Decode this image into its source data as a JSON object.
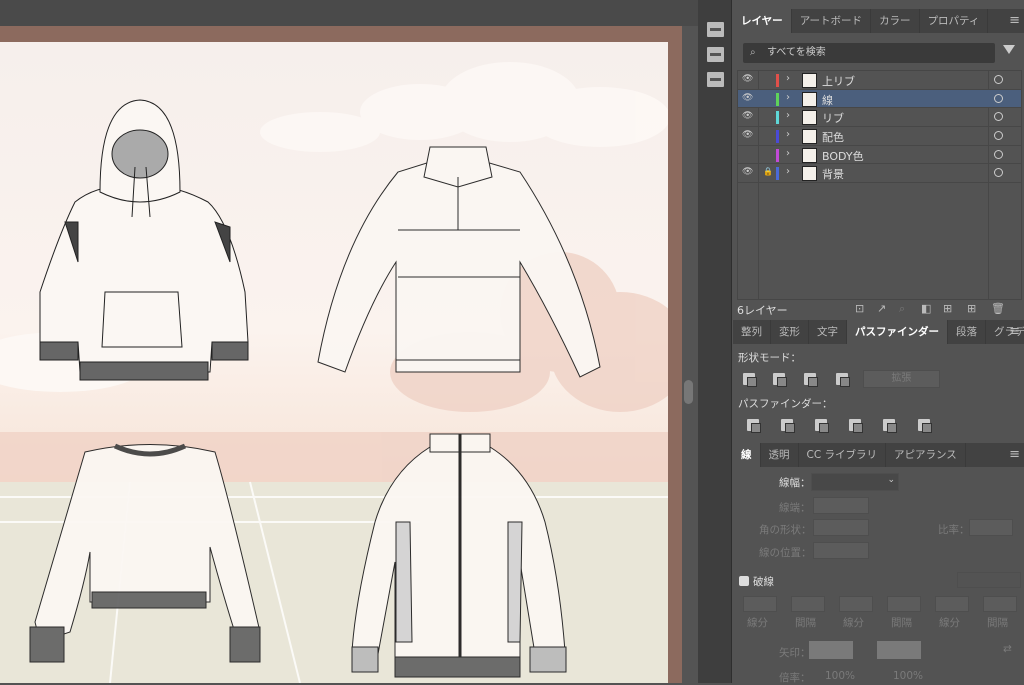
{
  "layers_panel": {
    "tabs": [
      "レイヤー",
      "アートボード",
      "カラー",
      "プロパティ"
    ],
    "search_placeholder": "すべてを検索",
    "layers": [
      {
        "name": "上リブ",
        "color": "#e0504a",
        "visible": true,
        "locked": false,
        "selected": false
      },
      {
        "name": "線",
        "color": "#5fd35a",
        "visible": true,
        "locked": false,
        "selected": true
      },
      {
        "name": "リブ",
        "color": "#5fd8d8",
        "visible": true,
        "locked": false,
        "selected": false
      },
      {
        "name": "配色",
        "color": "#4a4ad8",
        "visible": true,
        "locked": false,
        "selected": false
      },
      {
        "name": "BODY色",
        "color": "#c24ad8",
        "visible": false,
        "locked": false,
        "selected": false
      },
      {
        "name": "背景",
        "color": "#4a6ad8",
        "visible": true,
        "locked": true,
        "selected": false
      }
    ],
    "count_label": "6レイヤー"
  },
  "pathfinder_panel": {
    "tabs": [
      "整列",
      "変形",
      "文字",
      "パスファインダー",
      "段落",
      "グラデーシ"
    ],
    "shape_modes_label": "形状モード：",
    "expand_label": "拡張",
    "pathfinders_label": "パスファインダー："
  },
  "stroke_panel": {
    "tabs": [
      "線",
      "透明",
      "CC ライブラリ",
      "アピアランス"
    ],
    "weight_label": "線幅：",
    "cap_label": "線端：",
    "corner_label": "角の形状：",
    "limit_label": "比率：",
    "align_label": "線の位置：",
    "dashed_label": "破線",
    "dash_fields": [
      "線分",
      "間隔",
      "線分",
      "間隔",
      "線分",
      "間隔"
    ],
    "arrow_label": "矢印：",
    "scale_label": "倍率：",
    "scale_values": [
      "100%",
      "100%"
    ]
  }
}
